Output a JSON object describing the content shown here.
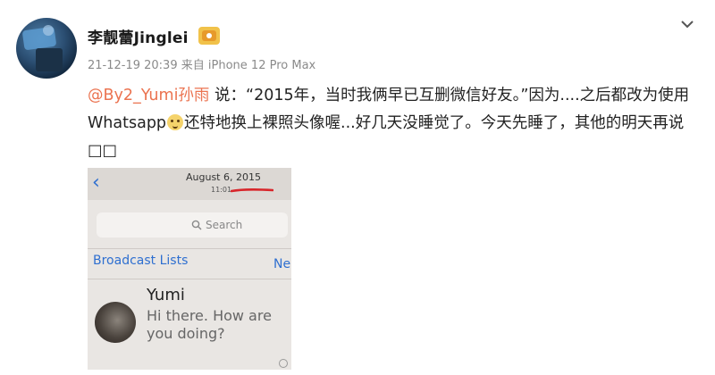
{
  "user": {
    "name": "李靓蕾Jinglei",
    "badge_icon": "vip-member-icon",
    "timestamp": "21-12-19 20:39",
    "source_prefix": "来自",
    "source_device": "iPhone 12 Pro Max"
  },
  "menu": {
    "icon": "chevron-down-icon"
  },
  "post": {
    "mention": "@By2_Yumi孙雨",
    "part1": " 说：“2015年，当时我俩早已互删微信好友。”因为....之后都改为使用 Whatsapp",
    "emoji_icon": "cat-emoji-icon",
    "part2": "还特地换上裸照头像喔...好几天没睡觉了。今天先睡了，其他的明天再说",
    "trailing_glyphs": "□□"
  },
  "screenshot": {
    "back_icon": "back-chevron-icon",
    "date": "August 6, 2015",
    "time": "11:01",
    "search_placeholder": "Search",
    "broadcast_label": "Broadcast Lists",
    "new_label": "Ne",
    "chat": {
      "name": "Yumi",
      "message": "Hi there. How are you doing?"
    },
    "colors": {
      "ios_blue": "#2e6fd0",
      "red_mark": "#d8262b"
    }
  },
  "colors": {
    "mention": "#eb7350",
    "meta": "#8a8a8a"
  }
}
